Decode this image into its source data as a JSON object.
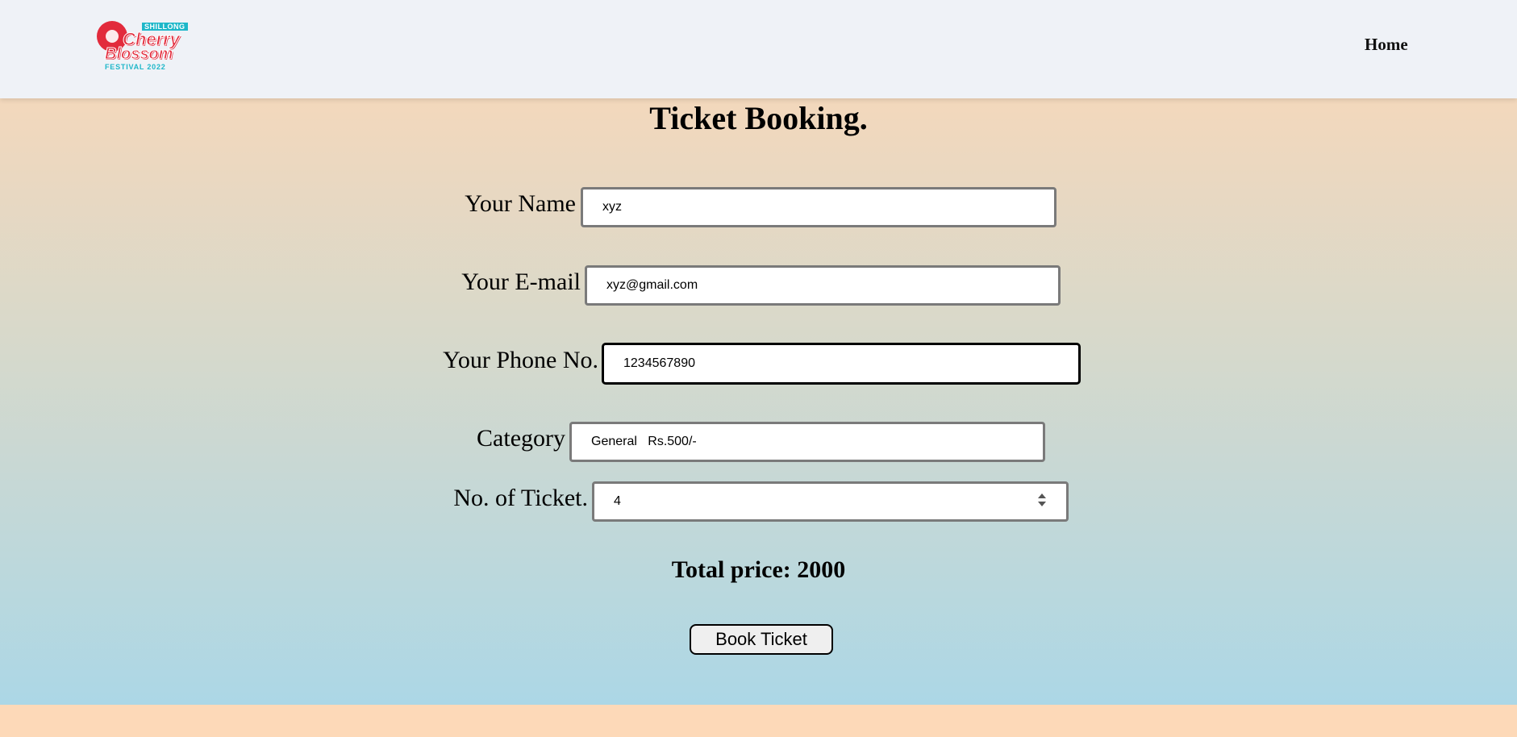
{
  "navbar": {
    "logo": {
      "tag_top": "SHILLONG",
      "word1": "Cherry",
      "word2": "Blossom",
      "tag_bottom": "FESTIVAL 2022"
    },
    "home_link": "Home"
  },
  "form": {
    "title": "Ticket Booking.",
    "name": {
      "label": "Your Name",
      "value": "xyz"
    },
    "email": {
      "label": "Your E-mail",
      "value": "xyz@gmail.com"
    },
    "phone": {
      "label": "Your Phone No.",
      "value": "1234567890"
    },
    "category": {
      "label": "Category",
      "value": "General   Rs.500/-"
    },
    "tickets": {
      "label": "No. of Ticket.",
      "value": "4"
    },
    "total": "Total price: 2000",
    "submit_label": "Book Ticket"
  },
  "colors": {
    "navbar_bg": "#eff2f7",
    "logo_red": "#e22b3c",
    "logo_teal": "#1eb7c9",
    "gradient_top": "#f3d8bc",
    "gradient_bottom": "#acd7e6",
    "footer_bg": "#fdd9b8"
  },
  "icons": {
    "logo": "cherry-blossom-logo",
    "spinner": "number-spinner-icon"
  }
}
